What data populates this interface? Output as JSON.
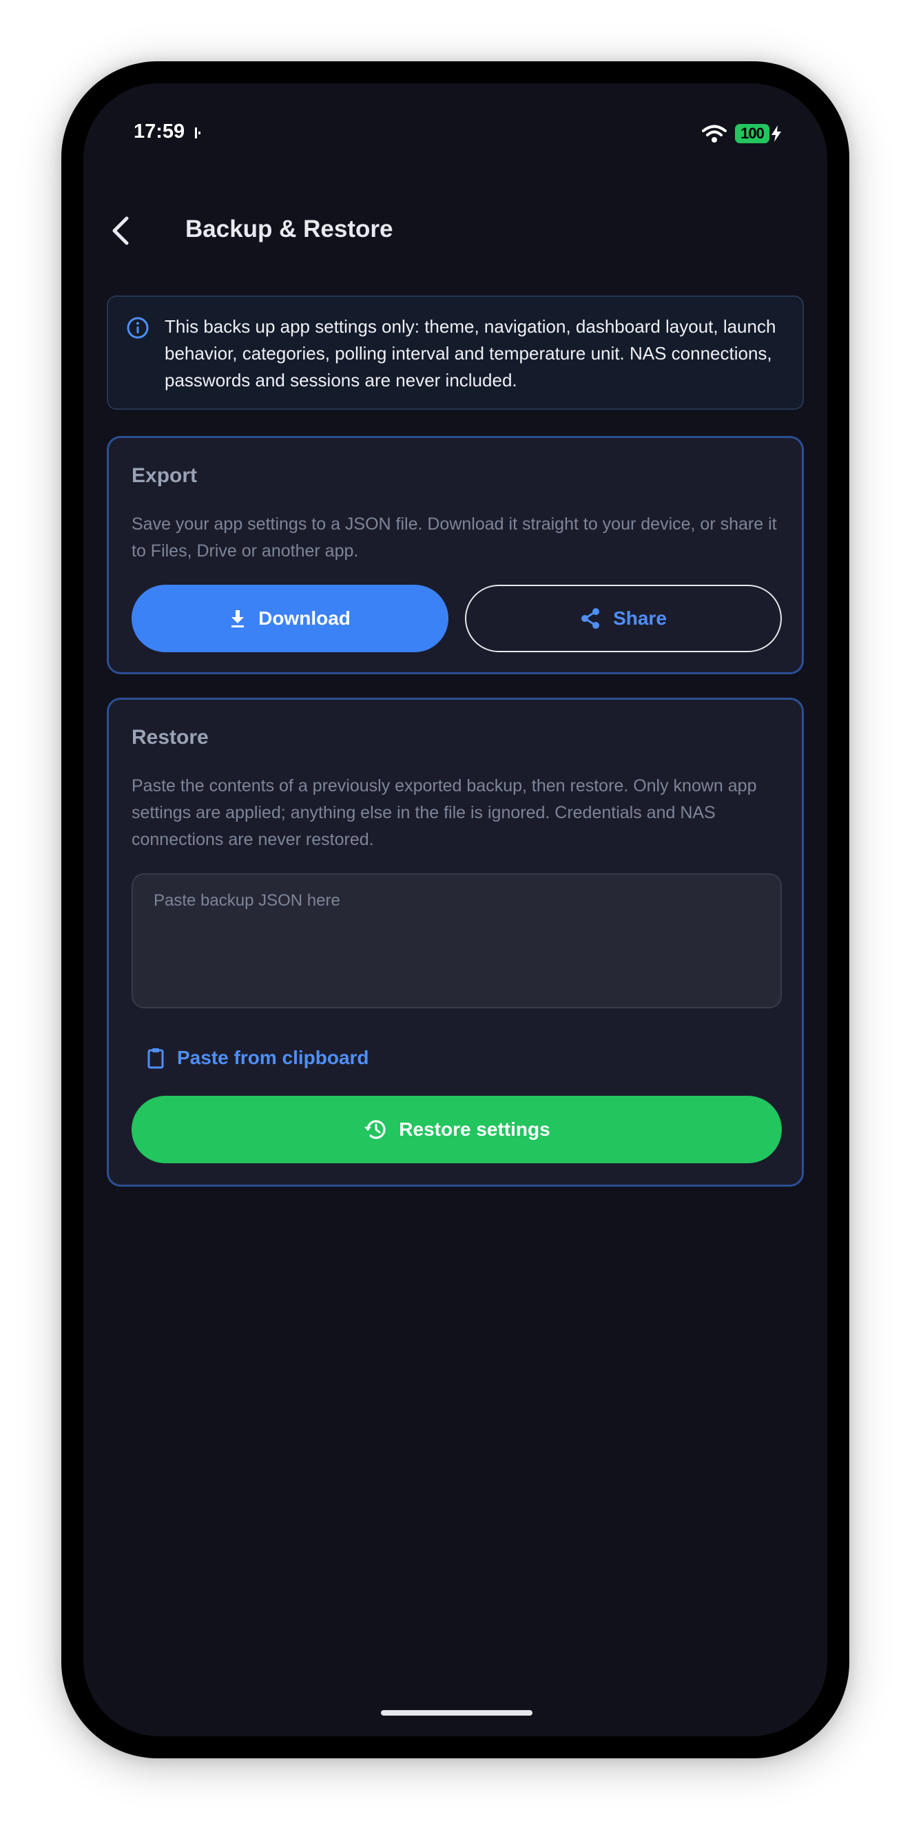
{
  "status_bar": {
    "time": "17:59",
    "battery": "100",
    "icons": [
      "sim-icon",
      "wifi-icon",
      "battery-icon",
      "charging-bolt-icon"
    ]
  },
  "header": {
    "back_icon": "chevron-left-icon",
    "title": "Backup & Restore"
  },
  "info": {
    "icon": "info-circle-icon",
    "text": "This backs up app settings only: theme, navigation, dashboard layout, launch behavior, categories, polling interval and temperature unit. NAS connections, passwords and sessions are never included."
  },
  "export": {
    "title": "Export",
    "description": "Save your app settings to a JSON file. Download it straight to your device, or share it to Files, Drive or another app.",
    "download_label": "Download",
    "download_icon": "download-icon",
    "share_label": "Share",
    "share_icon": "share-icon"
  },
  "restore": {
    "title": "Restore",
    "description": "Paste the contents of a previously exported backup, then restore. Only known app settings are applied; anything else in the file is ignored. Credentials and NAS connections are never restored.",
    "input_placeholder": "Paste backup JSON here",
    "input_value": "",
    "paste_label": "Paste from clipboard",
    "paste_icon": "clipboard-icon",
    "restore_label": "Restore settings",
    "restore_icon": "history-icon"
  },
  "colors": {
    "background": "#10111a",
    "card": "#1b1c2b",
    "card_border": "#2c4f94",
    "accent_blue": "#3b82f6",
    "accent_green": "#22c55e",
    "battery_green": "#22c55e"
  }
}
